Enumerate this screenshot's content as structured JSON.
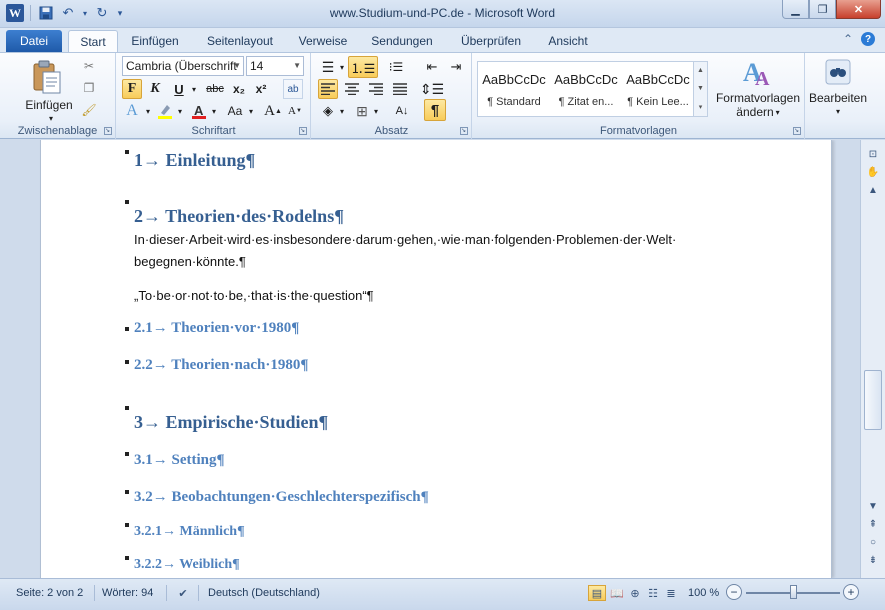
{
  "window": {
    "title": "www.Studium-und-PC.de  -  Microsoft Word"
  },
  "qat": {
    "word_icon": "W",
    "save_icon": "save-icon",
    "undo_icon": "undo-icon",
    "redo_icon": "redo-icon"
  },
  "tabs": [
    {
      "label": "Datei"
    },
    {
      "label": "Start"
    },
    {
      "label": "Einfügen"
    },
    {
      "label": "Seitenlayout"
    },
    {
      "label": "Verweise"
    },
    {
      "label": "Sendungen"
    },
    {
      "label": "Überprüfen"
    },
    {
      "label": "Ansicht"
    }
  ],
  "ribbon": {
    "clipboard": {
      "paste_label": "Einfügen",
      "group_label": "Zwischenablage"
    },
    "font": {
      "font_name": "Cambria (Überschrift",
      "font_size": "14",
      "bold": "F",
      "italic": "K",
      "underline": "U",
      "strike": "abc",
      "subscript": "x₂",
      "superscript": "x²",
      "grow": "A",
      "shrink": "A",
      "case": "Aa",
      "group_label": "Schriftart"
    },
    "paragraph": {
      "pilcrow": "¶",
      "group_label": "Absatz"
    },
    "styles": {
      "items": [
        {
          "preview": "AaBbCcDc",
          "name": "¶ Standard"
        },
        {
          "preview": "AaBbCcDc",
          "name": "¶ Zitat en..."
        },
        {
          "preview": "AaBbCcDc",
          "name": "¶ Kein Lee..."
        }
      ],
      "change_label_1": "Formatvorlagen",
      "change_label_2": "ändern",
      "group_label": "Formatvorlagen"
    },
    "editing": {
      "label": "Bearbeiten"
    }
  },
  "document": {
    "h1_einleitung": "1→ Einleitung¶",
    "h1_theorien": "2→ Theorien·des·Rodelns¶",
    "body_line1": "In·dieser·Arbeit·wird·es·insbesondere·darum·gehen,·wie·man·folgenden·Problemen·der·Welt·",
    "body_line2": "begegnen·könnte.¶",
    "quote": "„To·be·or·not·to·be,·that·is·the·question“¶",
    "h2_vor": "2.1→ Theorien·vor·1980¶",
    "h2_nach": "2.2→ Theorien·nach·1980¶",
    "h1_empirisch": "3→ Empirische·Studien¶",
    "h2_setting": "3.1→ Setting¶",
    "h2_beobachtungen": "3.2→ Beobachtungen·Geschlechterspezifisch¶",
    "h3_maennlich": "3.2.1→ Männlich¶",
    "h3_weiblich": "3.2.2→ Weiblich¶"
  },
  "statusbar": {
    "page": "Seite: 2 von 2",
    "words": "Wörter: 94",
    "language": "Deutsch (Deutschland)",
    "zoom": "100 %",
    "zoom_percent": 100
  }
}
